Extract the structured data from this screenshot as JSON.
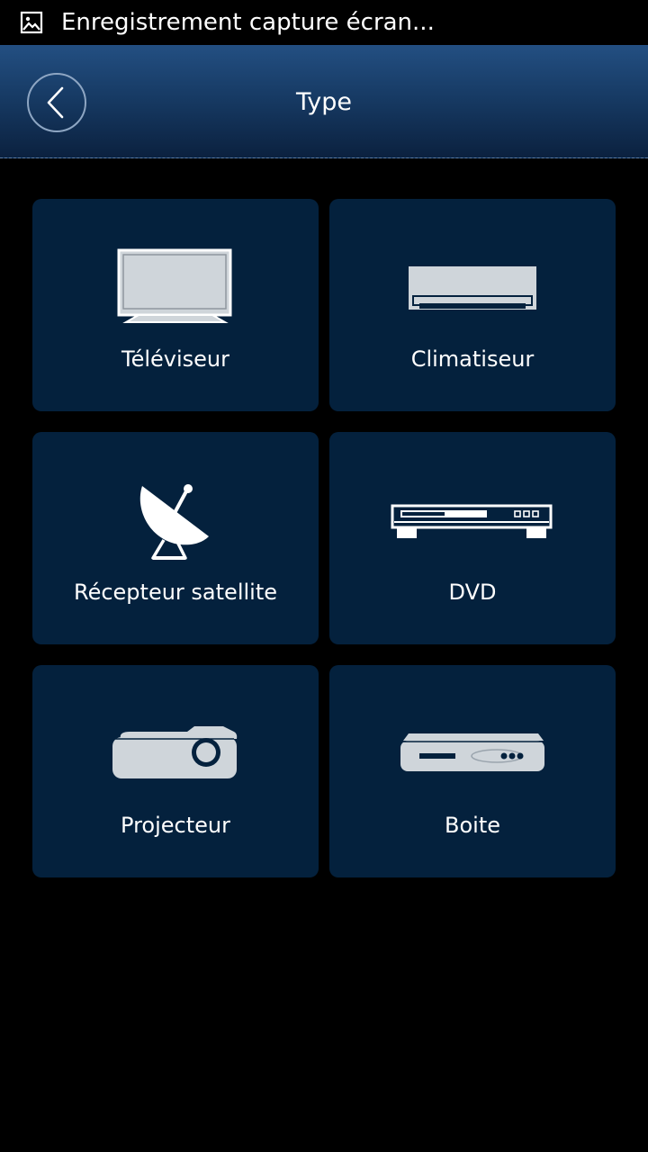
{
  "status_bar": {
    "text": "Enregistrement capture écran...",
    "icon": "image-icon"
  },
  "header": {
    "title": "Type",
    "back_icon": "chevron-left-icon"
  },
  "device_types": [
    {
      "label": "Téléviseur",
      "icon": "tv-icon"
    },
    {
      "label": "Climatiseur",
      "icon": "air-conditioner-icon"
    },
    {
      "label": "Récepteur satellite",
      "icon": "satellite-dish-icon"
    },
    {
      "label": "DVD",
      "icon": "dvd-player-icon"
    },
    {
      "label": "Projecteur",
      "icon": "projector-icon"
    },
    {
      "label": "Boite",
      "icon": "set-top-box-icon"
    }
  ],
  "colors": {
    "card_background": "#04213d",
    "header_top": "#234f82",
    "header_bottom": "#0b213f",
    "icon_fill": "#cfd5da"
  }
}
